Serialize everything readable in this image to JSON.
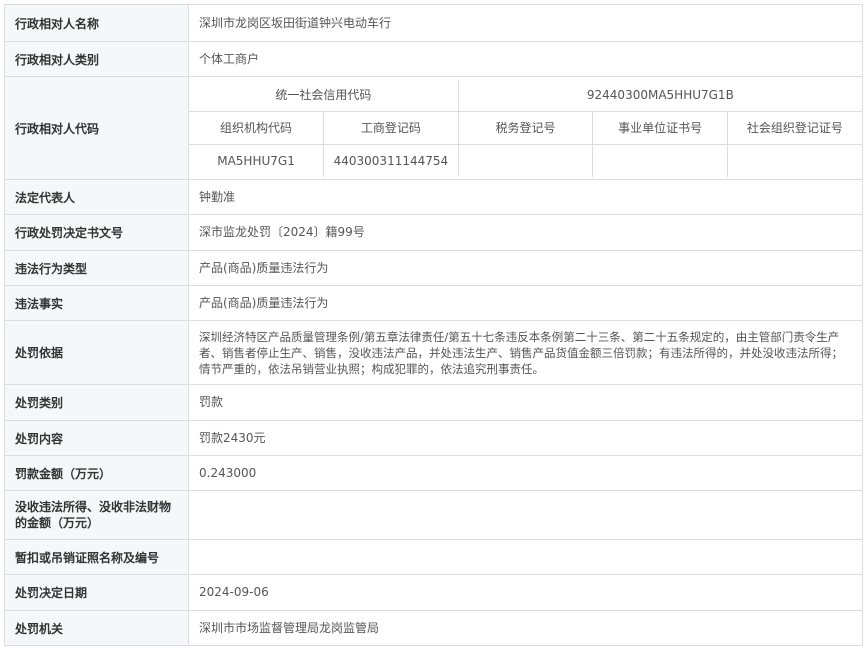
{
  "rows": {
    "name": {
      "label": "行政相对人名称",
      "value": "深圳市龙岗区坂田街道钟兴电动车行"
    },
    "category": {
      "label": "行政相对人类别",
      "value": "个体工商户"
    },
    "code": {
      "label": "行政相对人代码"
    },
    "legal_rep": {
      "label": "法定代表人",
      "value": "钟勤准"
    },
    "decision_no": {
      "label": "行政处罚决定书文号",
      "value": "深市监龙处罚〔2024〕籍99号"
    },
    "violation_type": {
      "label": "违法行为类型",
      "value": "产品(商品)质量违法行为"
    },
    "violation_fact": {
      "label": "违法事实",
      "value": "产品(商品)质量违法行为"
    },
    "basis": {
      "label": "处罚依据",
      "value": "深圳经济特区产品质量管理条例/第五章法律责任/第五十七条违反本条例第二十三条、第二十五条规定的，由主管部门责令生产者、销售者停止生产、销售，没收违法产品，并处违法生产、销售产品货值金额三倍罚款；有违法所得的，并处没收违法所得；情节严重的，依法吊销营业执照；构成犯罪的，依法追究刑事责任。"
    },
    "penalty_type": {
      "label": "处罚类别",
      "value": "罚款"
    },
    "penalty_content": {
      "label": "处罚内容",
      "value": "罚款2430元"
    },
    "fine_amount": {
      "label": "罚款金额（万元）",
      "value": "0.243000"
    },
    "confiscated": {
      "label": "没收违法所得、没收非法财物的金额（万元）",
      "value": ""
    },
    "license": {
      "label": "暂扣或吊销证照名称及编号",
      "value": ""
    },
    "decision_date": {
      "label": "处罚决定日期",
      "value": "2024-09-06"
    },
    "authority": {
      "label": "处罚机关",
      "value": "深圳市市场监督管理局龙岗监管局"
    }
  },
  "codes": {
    "uscc_label": "统一社会信用代码",
    "uscc_value": "92440300MA5HHU7G1B",
    "headers": [
      "组织机构代码",
      "工商登记码",
      "税务登记号",
      "事业单位证书号",
      "社会组织登记证号"
    ],
    "values": [
      "MA5HHU7G1",
      "440300311144754",
      "",
      "",
      ""
    ]
  }
}
